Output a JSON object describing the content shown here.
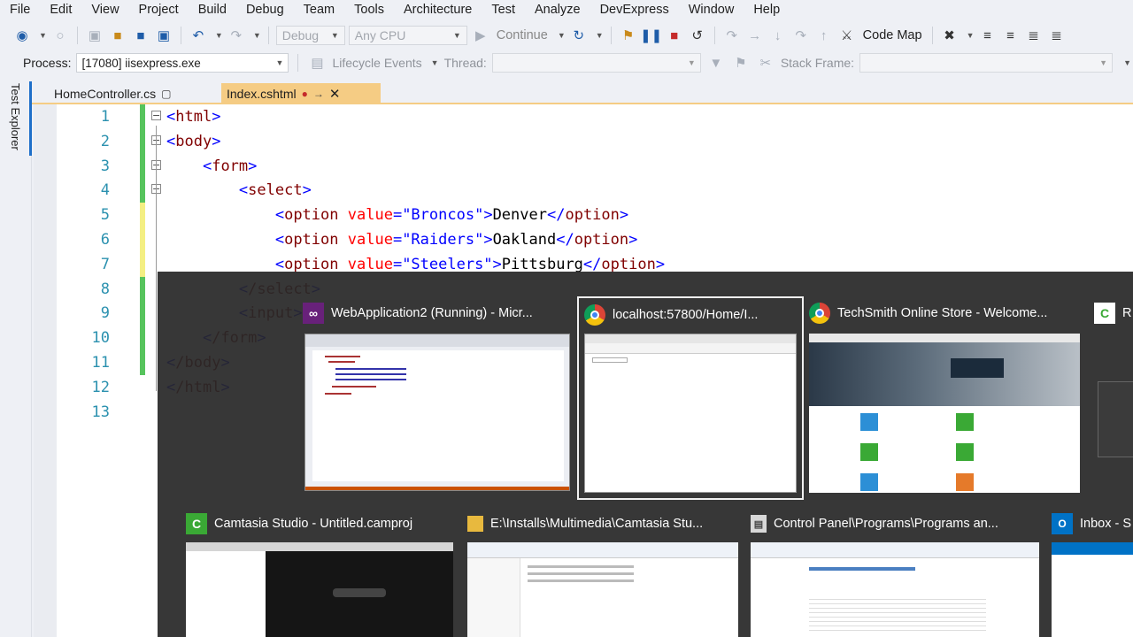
{
  "menu": [
    "File",
    "Edit",
    "View",
    "Project",
    "Build",
    "Debug",
    "Team",
    "Tools",
    "Architecture",
    "Test",
    "Analyze",
    "DevExpress",
    "Window",
    "Help"
  ],
  "toolbar": {
    "config": "Debug",
    "platform": "Any CPU",
    "continue_label": "Continue",
    "codemap_label": "Code Map"
  },
  "locationbar": {
    "process_label": "Process:",
    "process_value": "[17080] iisexpress.exe",
    "lifecycle_label": "Lifecycle Events",
    "thread_label": "Thread:",
    "stackframe_label": "Stack Frame:"
  },
  "sidebar": {
    "test_explorer": "Test Explorer"
  },
  "tabs": [
    {
      "label": "HomeController.cs",
      "active": false
    },
    {
      "label": "Index.cshtml",
      "active": true,
      "modified": true
    }
  ],
  "editor": {
    "line_numbers": [
      "1",
      "2",
      "3",
      "4",
      "5",
      "6",
      "7",
      "8",
      "9",
      "10",
      "11",
      "12",
      "13"
    ],
    "lines": [
      {
        "indent": "",
        "tag": "html"
      },
      {
        "indent": "",
        "tag": "body"
      },
      {
        "indent": "    ",
        "tag": "form"
      },
      {
        "indent": "        ",
        "tag": "select"
      },
      {
        "indent": "            ",
        "tag": "option",
        "attr": "value",
        "val": "\"Broncos\"",
        "text": "Denver"
      },
      {
        "indent": "            ",
        "tag": "option",
        "attr": "value",
        "val": "\"Raiders\"",
        "text": "Oakland"
      },
      {
        "indent": "            ",
        "tag": "option",
        "attr": "value",
        "val": "\"Steelers\"",
        "text": "Pittsburg"
      },
      {
        "indent": "        ",
        "tag": "/select"
      },
      {
        "indent": "        ",
        "tag": "input"
      },
      {
        "indent": "    ",
        "tag": "/form"
      },
      {
        "indent": "",
        "tag": "/body"
      },
      {
        "indent": "",
        "tag": "/html"
      },
      {
        "indent": "",
        "tag": ""
      }
    ]
  },
  "alttab": {
    "windows": [
      {
        "title": "WebApplication2 (Running) - Micr...",
        "icon": "visual-studio-icon",
        "selected": false
      },
      {
        "title": "localhost:57800/Home/I...",
        "icon": "chrome-icon",
        "selected": true
      },
      {
        "title": "TechSmith Online Store - Welcome...",
        "icon": "chrome-icon",
        "selected": false
      },
      {
        "title": "R",
        "icon": "camtasia-recorder-icon",
        "selected": false
      },
      {
        "title": "Camtasia Studio - Untitled.camproj",
        "icon": "camtasia-icon",
        "selected": false
      },
      {
        "title": "E:\\Installs\\Multimedia\\Camtasia Stu...",
        "icon": "folder-icon",
        "selected": false
      },
      {
        "title": "Control Panel\\Programs\\Programs an...",
        "icon": "control-panel-icon",
        "selected": false
      },
      {
        "title": "Inbox - S",
        "icon": "outlook-icon",
        "selected": false
      }
    ],
    "colors": {
      "chrome_red": "#db4437",
      "chrome_yellow": "#f4c20d",
      "chrome_green": "#0f9d58",
      "chrome_blue": "#4285f4",
      "camtasia_green": "#3aa935",
      "vs_purple": "#68217a",
      "outlook_blue": "#0072c6",
      "folder_yellow": "#e8b93e"
    }
  },
  "colors": {
    "tab_active": "#f5cc84",
    "change_green": "#57c45d",
    "change_yellow": "#f4ef83",
    "linenum": "#2b91af",
    "tag": "#800000",
    "attr": "#ff0000",
    "string": "#0000ff"
  }
}
